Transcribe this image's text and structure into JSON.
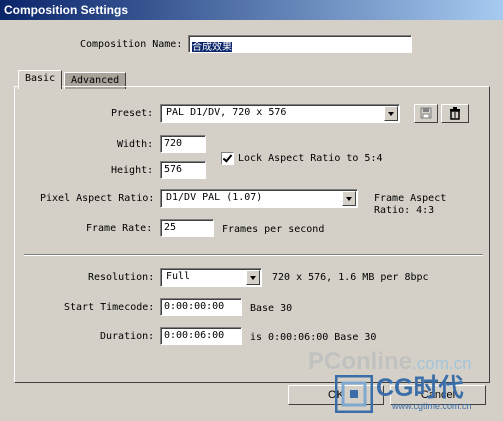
{
  "window": {
    "title": "Composition Settings"
  },
  "composition_name": {
    "label": "Composition Name:",
    "value": "合成效果"
  },
  "tabs": [
    {
      "label": "Basic"
    },
    {
      "label": "Advanced"
    }
  ],
  "preset": {
    "label": "Preset:",
    "value": "PAL D1/DV, 720 x 576"
  },
  "width": {
    "label": "Width:",
    "value": "720"
  },
  "height": {
    "label": "Height:",
    "value": "576"
  },
  "lock_aspect": {
    "label": "Lock Aspect Ratio to 5:4",
    "checked": true
  },
  "pixel_aspect": {
    "label": "Pixel Aspect Ratio:",
    "value": "D1/DV PAL (1.07)",
    "frame_aspect_line1": "Frame Aspect",
    "frame_aspect_line2": "Ratio: 4:3"
  },
  "frame_rate": {
    "label": "Frame Rate:",
    "value": "25",
    "unit": "Frames per second"
  },
  "resolution": {
    "label": "Resolution:",
    "value": "Full",
    "info": "720 x 576, 1.6 MB per 8bpc"
  },
  "start_timecode": {
    "label": "Start Timecode:",
    "value": "0:00:00:00",
    "base": "Base 30"
  },
  "duration": {
    "label": "Duration:",
    "value": "0:00:06:00",
    "info": "is 0:00:06:00  Base 30"
  },
  "buttons": {
    "ok": "OK",
    "cancel": "Cancel"
  },
  "icons": {
    "save": "save-icon",
    "delete": "trash-icon"
  },
  "watermark": {
    "line1": "PConline",
    "line1b": ".com.cn",
    "line2": "CG时代",
    "line3": "www.cgtime.com.cn"
  }
}
